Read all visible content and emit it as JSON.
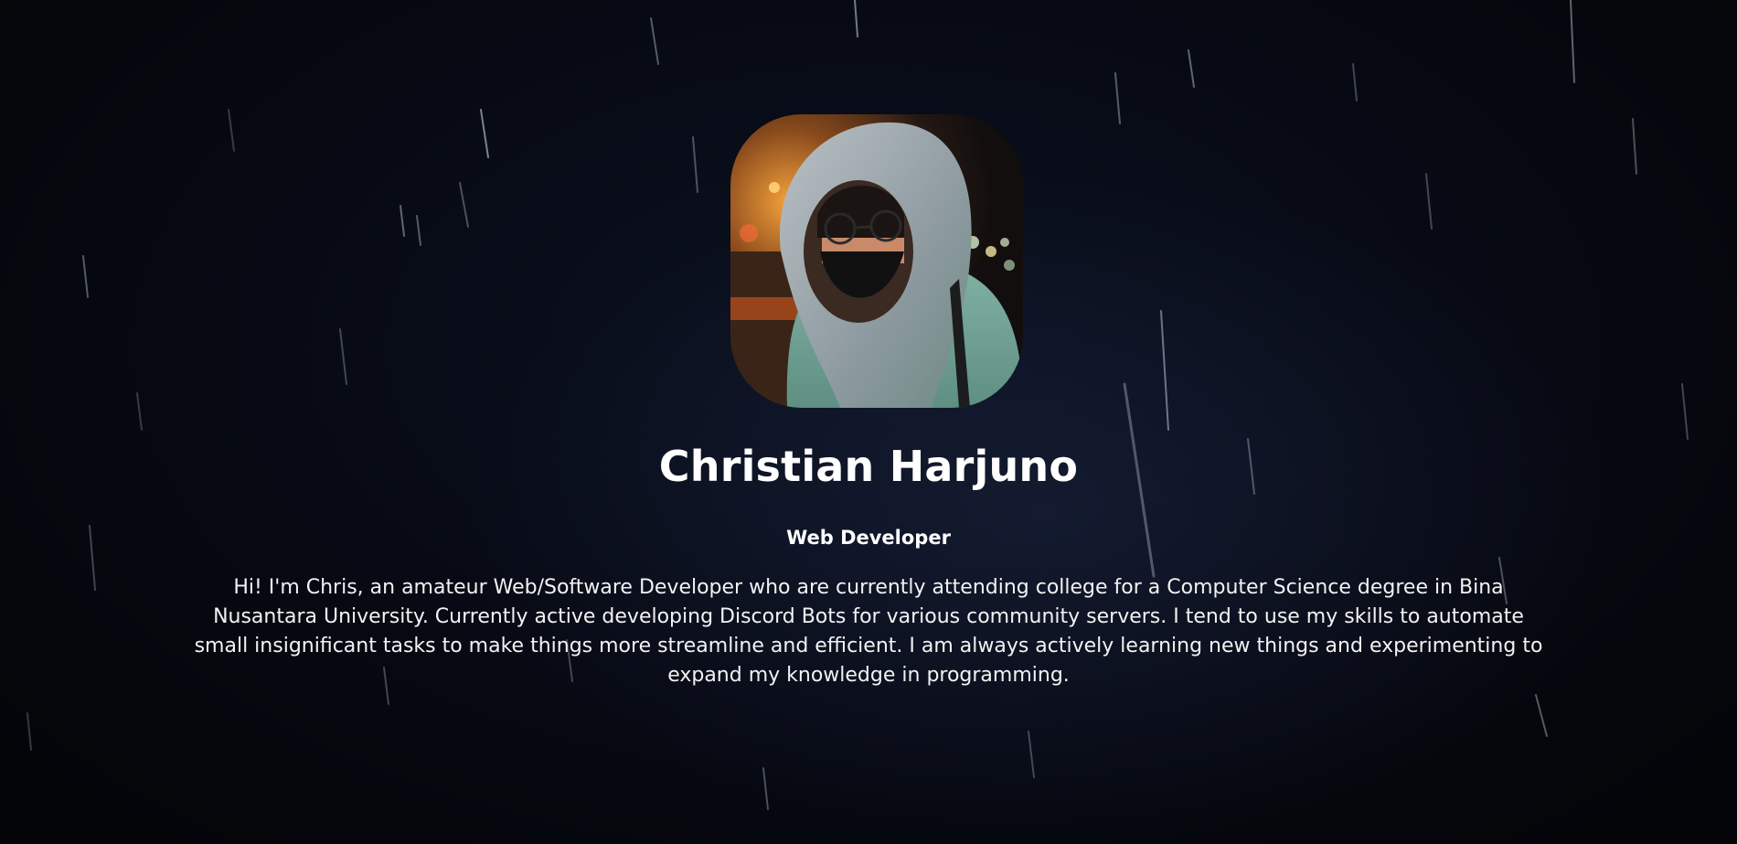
{
  "profile": {
    "name": "Christian Harjuno",
    "role": "Web Developer",
    "bio": "Hi! I'm Chris, an amateur Web/Software Developer who are currently attending college for a Computer Science degree in Bina Nusantara University. Currently active developing Discord Bots for various community servers. I tend to use my skills to automate small insignificant tasks to make things more streamline and efficient. I am always actively learning new things and experimenting to expand my knowledge in programming."
  },
  "colors": {
    "background": "#05070d",
    "text": "#ffffff",
    "rain": "#c9d4ea"
  }
}
